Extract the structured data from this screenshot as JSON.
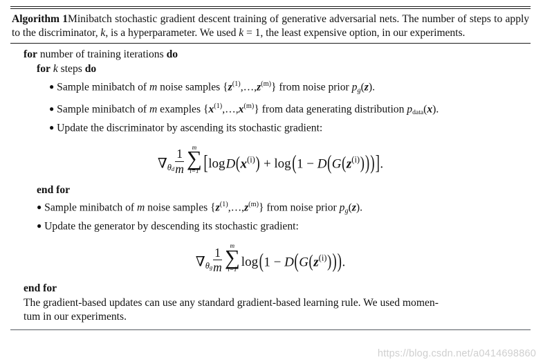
{
  "document": {
    "type": "algorithm-block",
    "label": "Algorithm 1",
    "caption_text": "Minibatch stochastic gradient descent training of generative adversarial nets. The number of steps to apply to the discriminator, k, is a hyperparameter. We used k = 1, the least expensive option, in our experiments."
  },
  "caption": {
    "label": "Algorithm 1",
    "part1": "Minibatch stochastic gradient descent training of generative adversarial nets.  The number of steps to apply to the discriminator, ",
    "k1": "k",
    "part2": ", is a hyperparameter. We used ",
    "k2": "k",
    "eq": " = 1",
    "part3": ", the least expensive option, in our experiments."
  },
  "body": {
    "for_outer": {
      "kw_for": "for",
      "text": "number of training iterations",
      "kw_do": "do"
    },
    "for_inner": {
      "kw_for": "for",
      "var_k": "k",
      "text": "steps",
      "kw_do": "do"
    },
    "bullet1": {
      "lead": "Sample minibatch of ",
      "m": "m",
      "mid": " noise samples ",
      "set_open": "{",
      "z1": "z",
      "z1_sup": "(1)",
      "dots": ",…,",
      "zm": "z",
      "zm_sup": "(m)",
      "set_close": "}",
      "tail": " from noise prior ",
      "p": "p",
      "p_sub": "g",
      "p_arg_open": "(",
      "p_arg": "z",
      "p_arg_close": ")",
      "period": "."
    },
    "bullet2": {
      "lead": "Sample minibatch of ",
      "m": "m",
      "mid": " examples ",
      "set_open": "{",
      "x1": "x",
      "x1_sup": "(1)",
      "dots": ",…,",
      "xm": "x",
      "xm_sup": "(m)",
      "set_close": "}",
      "tail": " from data generating distribution ",
      "p": "p",
      "p_sub": "data",
      "p_arg_open": "(",
      "p_arg": "x",
      "p_arg_close": ")",
      "period": "."
    },
    "bullet3": {
      "text": "Update the discriminator by ascending its stochastic gradient:"
    },
    "end_for_inner": "end for",
    "bullet4": {
      "lead": "Sample minibatch of ",
      "m": "m",
      "mid": " noise samples ",
      "set_open": "{",
      "z1": "z",
      "z1_sup": "(1)",
      "dots": ",…,",
      "zm": "z",
      "zm_sup": "(m)",
      "set_close": "}",
      "tail": " from noise prior ",
      "p": "p",
      "p_sub": "g",
      "p_arg_open": "(",
      "p_arg": "z",
      "p_arg_close": ")",
      "period": "."
    },
    "bullet5": {
      "text": "Update the generator by descending its stochastic gradient:"
    },
    "end_for_outer": "end for",
    "closing": {
      "line1": "The gradient-based updates can use any standard gradient-based learning rule.  We used momen-",
      "line2": "tum in our experiments."
    }
  },
  "equations": {
    "discriminator": {
      "latex": "\\nabla_{\\theta_d} \\frac{1}{m} \\sum_{i=1}^{m} \\left[ \\log D\\left(x^{(i)}\\right) + \\log\\left(1 - D\\left(G\\left(z^{(i)}\\right)\\right)\\right) \\right].",
      "nabla": "∇",
      "theta": "θ",
      "theta_sub": "d",
      "num": "1",
      "den": "m",
      "sum_top": "m",
      "sum_glyph": "∑",
      "sum_bottom": "i=1",
      "bracket_open": "[",
      "log1": "log",
      "D1": "D",
      "paren_open": "(",
      "x": "x",
      "x_sup": "(i)",
      "paren_close": ")",
      "plus": "+",
      "log2": "log",
      "one": "1",
      "minus": "−",
      "D2": "D",
      "G": "G",
      "z": "z",
      "z_sup": "(i)",
      "bracket_close": "]",
      "period": "."
    },
    "generator": {
      "latex": "\\nabla_{\\theta_g} \\frac{1}{m} \\sum_{i=1}^{m} \\log\\left(1 - D\\left(G\\left(z^{(i)}\\right)\\right)\\right).",
      "nabla": "∇",
      "theta": "θ",
      "theta_sub": "g",
      "num": "1",
      "den": "m",
      "sum_top": "m",
      "sum_glyph": "∑",
      "sum_bottom": "i=1",
      "log": "log",
      "paren_open": "(",
      "one": "1",
      "minus": "−",
      "D": "D",
      "G": "G",
      "z": "z",
      "z_sup": "(i)",
      "paren_close": ")",
      "period": "."
    }
  },
  "watermark": {
    "text": "https://blog.csdn.net/a0414698860"
  }
}
